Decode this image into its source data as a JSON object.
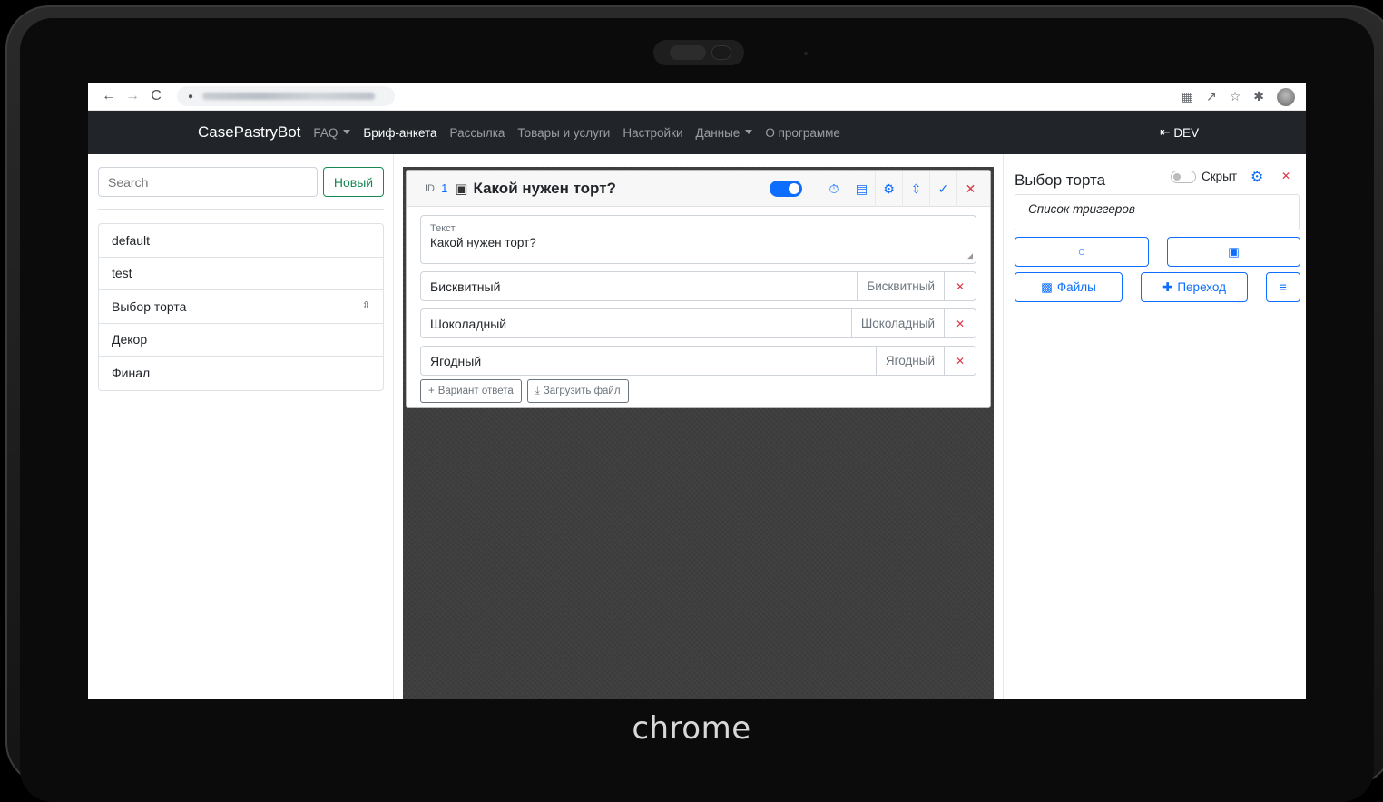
{
  "device": {
    "brand": "chrome"
  },
  "browser": {
    "nav_back": "←",
    "nav_forward": "→",
    "nav_reload": "C",
    "lock": "🔒"
  },
  "navbar": {
    "logo": "CasePastryBot",
    "items": [
      {
        "label": "FAQ",
        "dropdown": true,
        "active": false
      },
      {
        "label": "Бриф-анкета",
        "dropdown": false,
        "active": true
      },
      {
        "label": "Рассылка",
        "dropdown": false,
        "active": false
      },
      {
        "label": "Товары и услуги",
        "dropdown": false,
        "active": false
      },
      {
        "label": "Настройки",
        "dropdown": false,
        "active": false
      },
      {
        "label": "Данные",
        "dropdown": true,
        "active": false
      },
      {
        "label": "О программе",
        "dropdown": false,
        "active": false
      }
    ],
    "dev_label": "DEV"
  },
  "sidebar": {
    "search_placeholder": "Search",
    "new_button": "Новый",
    "items": [
      "default",
      "test",
      "Выбор торта",
      "Декор",
      "Финал"
    ]
  },
  "question": {
    "id_label": "ID:",
    "id_value": "1",
    "title": "Какой нужен торт?",
    "enabled": true,
    "text_label": "Текст",
    "text_value": "Какой нужен торт?",
    "answers": [
      {
        "value": "Бисквитный",
        "tag": "Бисквитный"
      },
      {
        "value": "Шоколадный",
        "tag": "Шоколадный"
      },
      {
        "value": "Ягодный",
        "tag": "Ягодный"
      }
    ],
    "add_answer": "Вариант ответа",
    "upload_file": "Загрузить файл"
  },
  "right_panel": {
    "title": "Выбор торта",
    "hidden_label": "Скрыт",
    "hidden": false,
    "triggers_label": "Список триггеров",
    "files_button": "Файлы",
    "transition_button": "Переход"
  },
  "colors": {
    "primary": "#0d6efd",
    "success": "#198754",
    "danger": "#dc3545",
    "navbar": "#212529"
  }
}
